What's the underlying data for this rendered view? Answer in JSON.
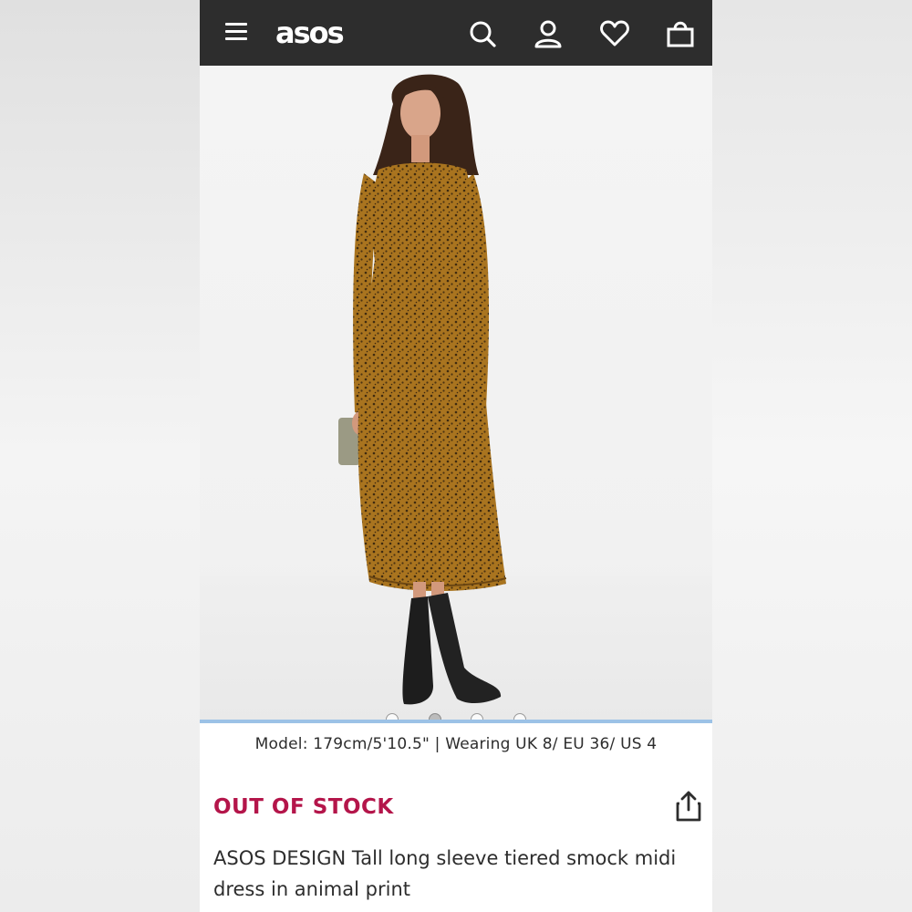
{
  "header": {
    "logo": "asos",
    "icons": [
      "menu-icon",
      "search-icon",
      "account-icon",
      "heart-icon",
      "bag-icon"
    ]
  },
  "gallery": {
    "total_images": 4,
    "active_index": 2
  },
  "product": {
    "model_info": "Model: 179cm/5'10.5\" | Wearing UK 8/ EU 36/ US 4",
    "stock_status": "OUT OF STOCK",
    "title": "ASOS DESIGN Tall long sleeve tiered smock midi dress in animal print"
  },
  "colors": {
    "header_bg": "#2d2d2d",
    "stock_status": "#b4154a",
    "divider": "#9cc2e6",
    "dress": "#9b6a20"
  }
}
